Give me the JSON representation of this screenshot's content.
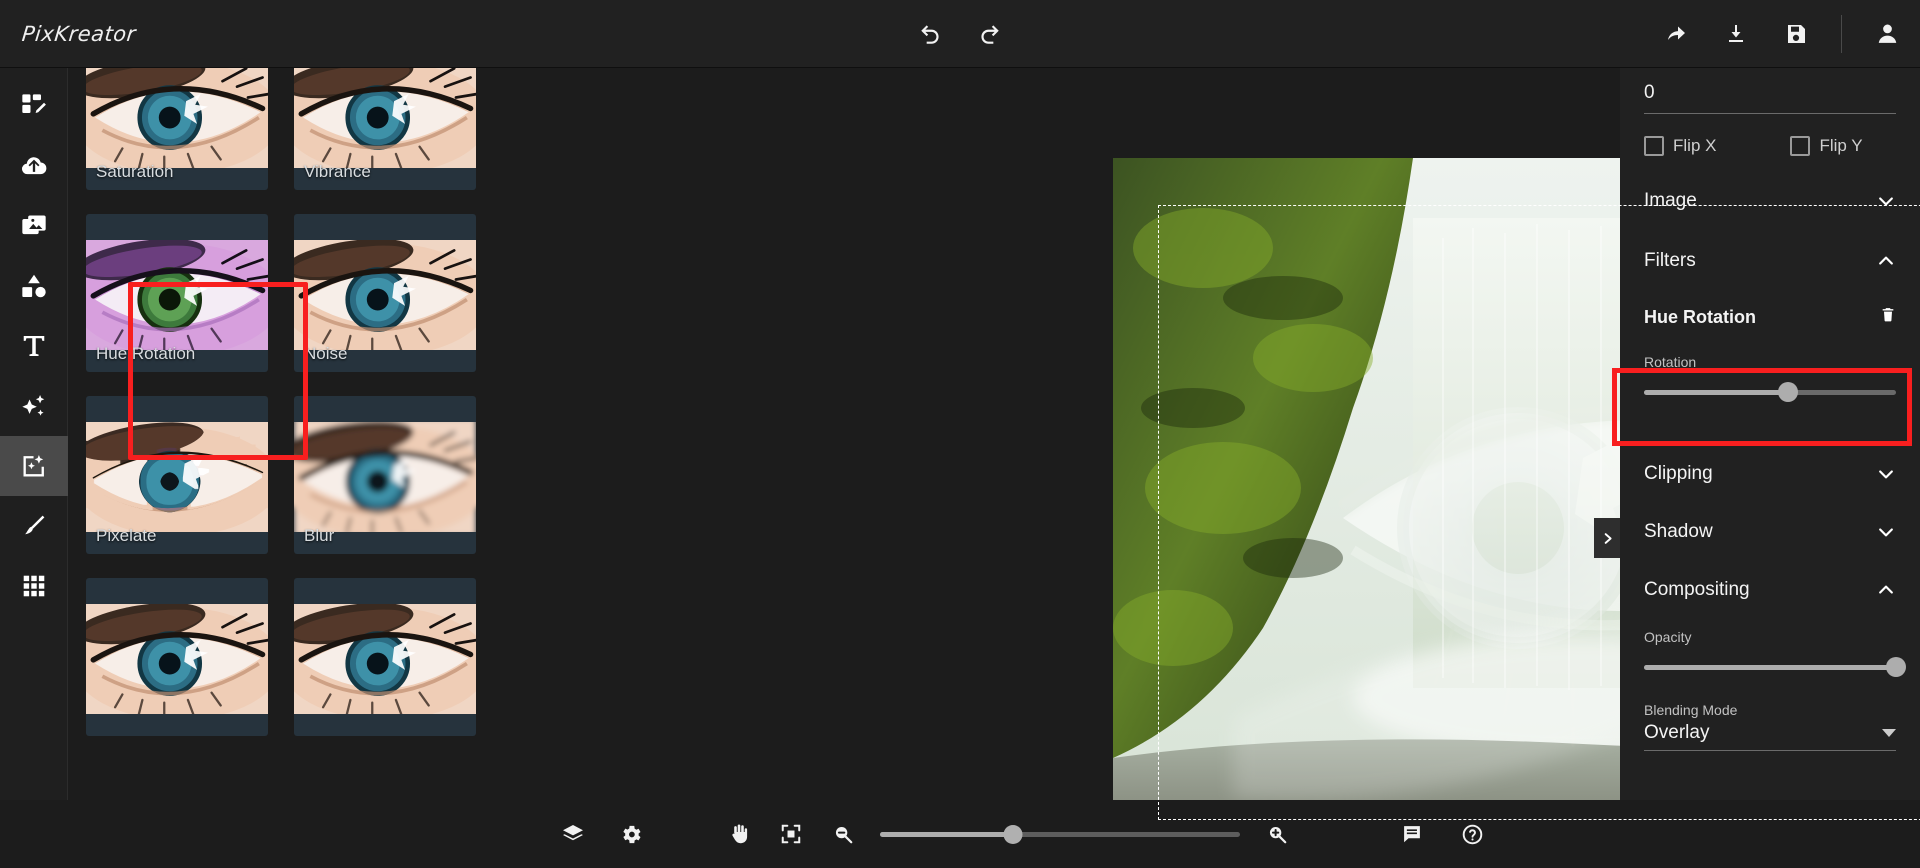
{
  "app": {
    "title": "PixKreator"
  },
  "header": {
    "undo": "undo-icon",
    "redo": "redo-icon",
    "share": "share-icon",
    "download": "download-icon",
    "save": "save-icon",
    "account": "account-icon"
  },
  "rail": {
    "items": [
      {
        "name": "templates",
        "icon": "template-edit-icon",
        "active": false
      },
      {
        "name": "uploads",
        "icon": "cloud-upload-icon",
        "active": false
      },
      {
        "name": "photos",
        "icon": "images-icon",
        "active": false
      },
      {
        "name": "elements",
        "icon": "shapes-icon",
        "active": false
      },
      {
        "name": "text",
        "icon": "text-icon",
        "active": false
      },
      {
        "name": "effects",
        "icon": "sparkles-icon",
        "active": false
      },
      {
        "name": "photo-effects",
        "icon": "photo-magic-icon",
        "active": true
      },
      {
        "name": "draw",
        "icon": "brush-icon",
        "active": false
      },
      {
        "name": "more",
        "icon": "grid-icon",
        "active": false
      }
    ]
  },
  "gallery": {
    "cards": [
      {
        "label": "Saturation",
        "selected": false
      },
      {
        "label": "Vibrance",
        "selected": false
      },
      {
        "label": "Hue Rotation",
        "selected": true
      },
      {
        "label": "Noise",
        "selected": false
      },
      {
        "label": "Pixelate",
        "selected": false
      },
      {
        "label": "Blur",
        "selected": false
      },
      {
        "label": "",
        "selected": false
      },
      {
        "label": "",
        "selected": false
      }
    ]
  },
  "canvas": {
    "panel_toggle": "chevron-right-icon",
    "selection": "marquee-selection"
  },
  "properties": {
    "rotation_value": "0",
    "flip_x": "Flip X",
    "flip_y": "Flip Y",
    "image_section": "Image",
    "filters_section": "Filters",
    "filter_name": "Hue Rotation",
    "delete_filter": "trash-icon",
    "rotation_label": "Rotation",
    "rotation_percent": 57,
    "clipping_section": "Clipping",
    "shadow_section": "Shadow",
    "compositing_section": "Compositing",
    "opacity_label": "Opacity",
    "opacity_percent": 100,
    "blending_label": "Blending Mode",
    "blending_value": "Overlay"
  },
  "bottombar": {
    "layers": "layers-icon",
    "settings": "gear-icon",
    "pan": "hand-icon",
    "fit": "fit-screen-icon",
    "zoom_out": "zoom-out-icon",
    "zoom_in": "zoom-in-icon",
    "zoom_percent": 37,
    "comments": "comment-icon",
    "help": "help-icon"
  },
  "highlights": {
    "card_highlight_color": "#f81f1f",
    "control_highlight_color": "#f81f1f"
  }
}
